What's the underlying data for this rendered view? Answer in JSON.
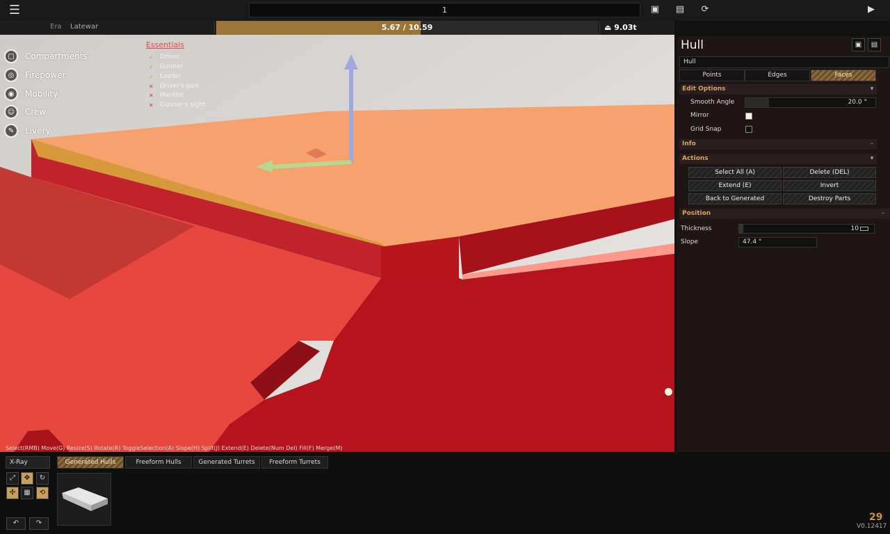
{
  "topbar": {
    "title_value": "1",
    "icons": [
      "menu-icon",
      "save-icon",
      "load-icon",
      "refresh-icon",
      "play-icon"
    ]
  },
  "era": {
    "label": "Era",
    "value": "Latewar"
  },
  "weight": {
    "text": "5.67 / 10.59",
    "current": 5.67,
    "max": 10.59
  },
  "tonnage": "9.03t",
  "nav": {
    "items": [
      {
        "label": "Compartments",
        "icon": "compartment-icon"
      },
      {
        "label": "Firepower",
        "icon": "gun-icon"
      },
      {
        "label": "Mobility",
        "icon": "wheel-icon"
      },
      {
        "label": "Crew",
        "icon": "crew-icon"
      },
      {
        "label": "Livery",
        "icon": "brush-icon"
      }
    ]
  },
  "essentials": {
    "title": "Essentials",
    "items": [
      {
        "label": "Driver",
        "ok": true
      },
      {
        "label": "Gunner",
        "ok": true
      },
      {
        "label": "Loader",
        "ok": true
      },
      {
        "label": "Driver's port",
        "ok": false
      },
      {
        "label": "Mantlet",
        "ok": false
      },
      {
        "label": "Gunner's sight",
        "ok": false
      }
    ]
  },
  "shortcuts": "Select(RMB) Move(G) Resize(S) Rotate(R) ToggleSelection(A) Slope(H) Split(J) Extend(E) Delete(Num Del) Fill(F) Merge(M)",
  "panel": {
    "title": "Hull",
    "name_value": "Hull",
    "tabs": [
      "Points",
      "Edges",
      "Faces"
    ],
    "edit_options": {
      "title": "Edit Options",
      "smooth_angle_label": "Smooth Angle",
      "smooth_angle_value": "20.0 °",
      "mirror_label": "Mirror",
      "mirror_checked": true,
      "grid_snap_label": "Grid Snap",
      "grid_snap_checked": false
    },
    "info": {
      "title": "Info"
    },
    "actions": {
      "title": "Actions",
      "buttons": [
        "Select All (A)",
        "Delete (DEL)",
        "Extend (E)",
        "Invert",
        "Back to Generated",
        "Destroy Parts"
      ]
    },
    "position": {
      "title": "Position",
      "thickness_label": "Thickness",
      "thickness_value": "10",
      "slope_label": "Slope",
      "slope_value": "47.4 °"
    }
  },
  "bottom": {
    "xray_label": "X-Ray",
    "tabs": [
      "Generated Hulls",
      "Freeform Hulls",
      "Generated Turrets",
      "Freeform Turrets"
    ],
    "fps": "29",
    "version": "V0.12417"
  },
  "colors": {
    "accent": "#c9933f",
    "hull_top": "#f7a26d",
    "hull_side": "#e8483c",
    "hull_dark": "#b5141c"
  }
}
